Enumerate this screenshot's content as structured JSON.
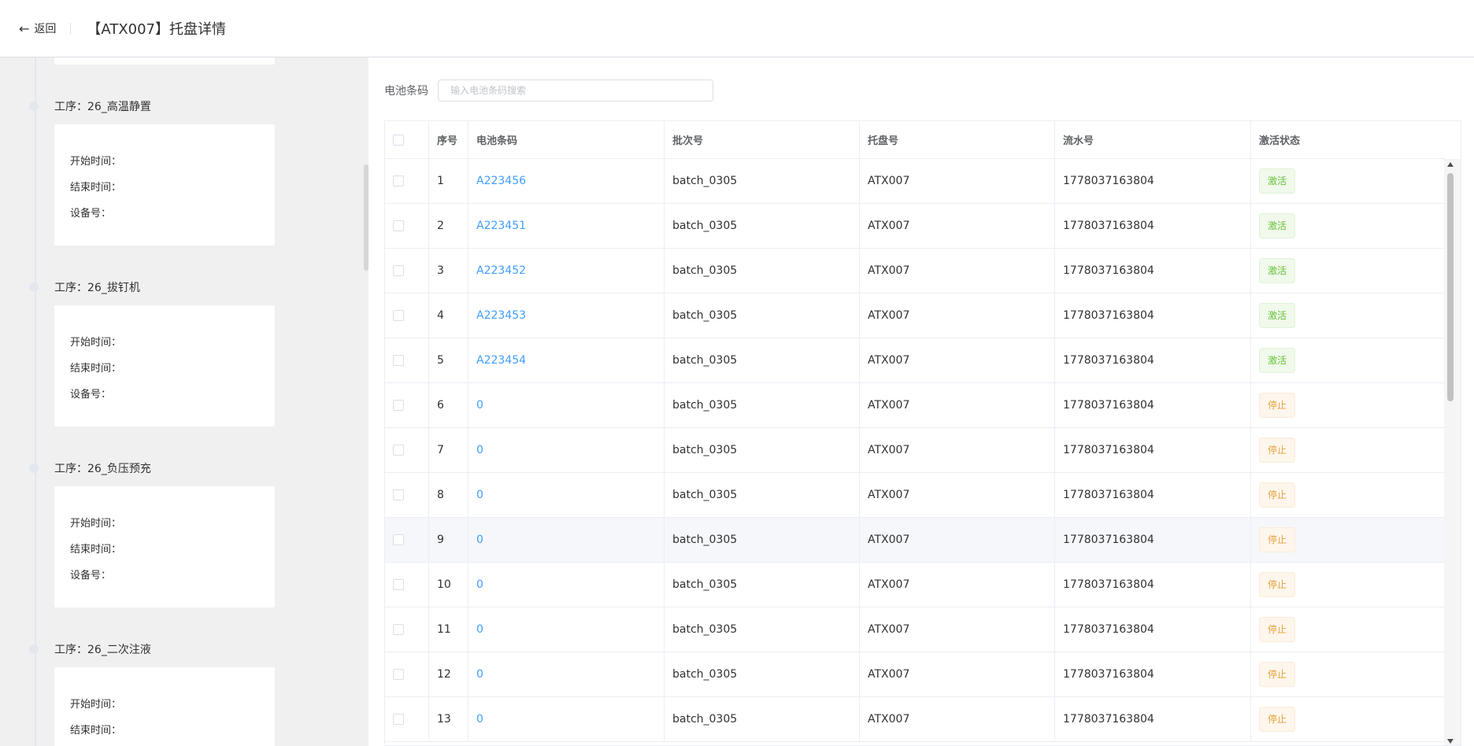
{
  "header": {
    "back_label": "返回",
    "title": "【ATX007】托盘详情"
  },
  "timeline": {
    "steps": [
      {
        "label": "工序：26_高温静置",
        "start_label": "开始时间：",
        "end_label": "结束时间：",
        "device_label": "设备号："
      },
      {
        "label": "工序：26_拔钉机",
        "start_label": "开始时间：",
        "end_label": "结束时间：",
        "device_label": "设备号："
      },
      {
        "label": "工序：26_负压预充",
        "start_label": "开始时间：",
        "end_label": "结束时间：",
        "device_label": "设备号："
      },
      {
        "label": "工序：26_二次注液",
        "start_label": "开始时间：",
        "end_label": "结束时间："
      }
    ]
  },
  "search": {
    "label": "电池条码",
    "placeholder": "输入电池条码搜索"
  },
  "table": {
    "headers": [
      "序号",
      "电池条码",
      "批次号",
      "托盘号",
      "流水号",
      "激活状态"
    ],
    "rows": [
      {
        "no": "1",
        "barcode": "A223456",
        "batch": "batch_0305",
        "tray": "ATX007",
        "serial": "1778037163804",
        "status": "激活"
      },
      {
        "no": "2",
        "barcode": "A223451",
        "batch": "batch_0305",
        "tray": "ATX007",
        "serial": "1778037163804",
        "status": "激活"
      },
      {
        "no": "3",
        "barcode": "A223452",
        "batch": "batch_0305",
        "tray": "ATX007",
        "serial": "1778037163804",
        "status": "激活"
      },
      {
        "no": "4",
        "barcode": "A223453",
        "batch": "batch_0305",
        "tray": "ATX007",
        "serial": "1778037163804",
        "status": "激活"
      },
      {
        "no": "5",
        "barcode": "A223454",
        "batch": "batch_0305",
        "tray": "ATX007",
        "serial": "1778037163804",
        "status": "激活"
      },
      {
        "no": "6",
        "barcode": "0",
        "batch": "batch_0305",
        "tray": "ATX007",
        "serial": "1778037163804",
        "status": "停止"
      },
      {
        "no": "7",
        "barcode": "0",
        "batch": "batch_0305",
        "tray": "ATX007",
        "serial": "1778037163804",
        "status": "停止"
      },
      {
        "no": "8",
        "barcode": "0",
        "batch": "batch_0305",
        "tray": "ATX007",
        "serial": "1778037163804",
        "status": "停止"
      },
      {
        "no": "9",
        "barcode": "0",
        "batch": "batch_0305",
        "tray": "ATX007",
        "serial": "1778037163804",
        "status": "停止"
      },
      {
        "no": "10",
        "barcode": "0",
        "batch": "batch_0305",
        "tray": "ATX007",
        "serial": "1778037163804",
        "status": "停止"
      },
      {
        "no": "11",
        "barcode": "0",
        "batch": "batch_0305",
        "tray": "ATX007",
        "serial": "1778037163804",
        "status": "停止"
      },
      {
        "no": "12",
        "barcode": "0",
        "batch": "batch_0305",
        "tray": "ATX007",
        "serial": "1778037163804",
        "status": "停止"
      },
      {
        "no": "13",
        "barcode": "0",
        "batch": "batch_0305",
        "tray": "ATX007",
        "serial": "1778037163804",
        "status": "停止"
      }
    ]
  },
  "colors": {
    "active": "#67c23a",
    "stopped": "#e6a23c",
    "link": "#409eff"
  }
}
